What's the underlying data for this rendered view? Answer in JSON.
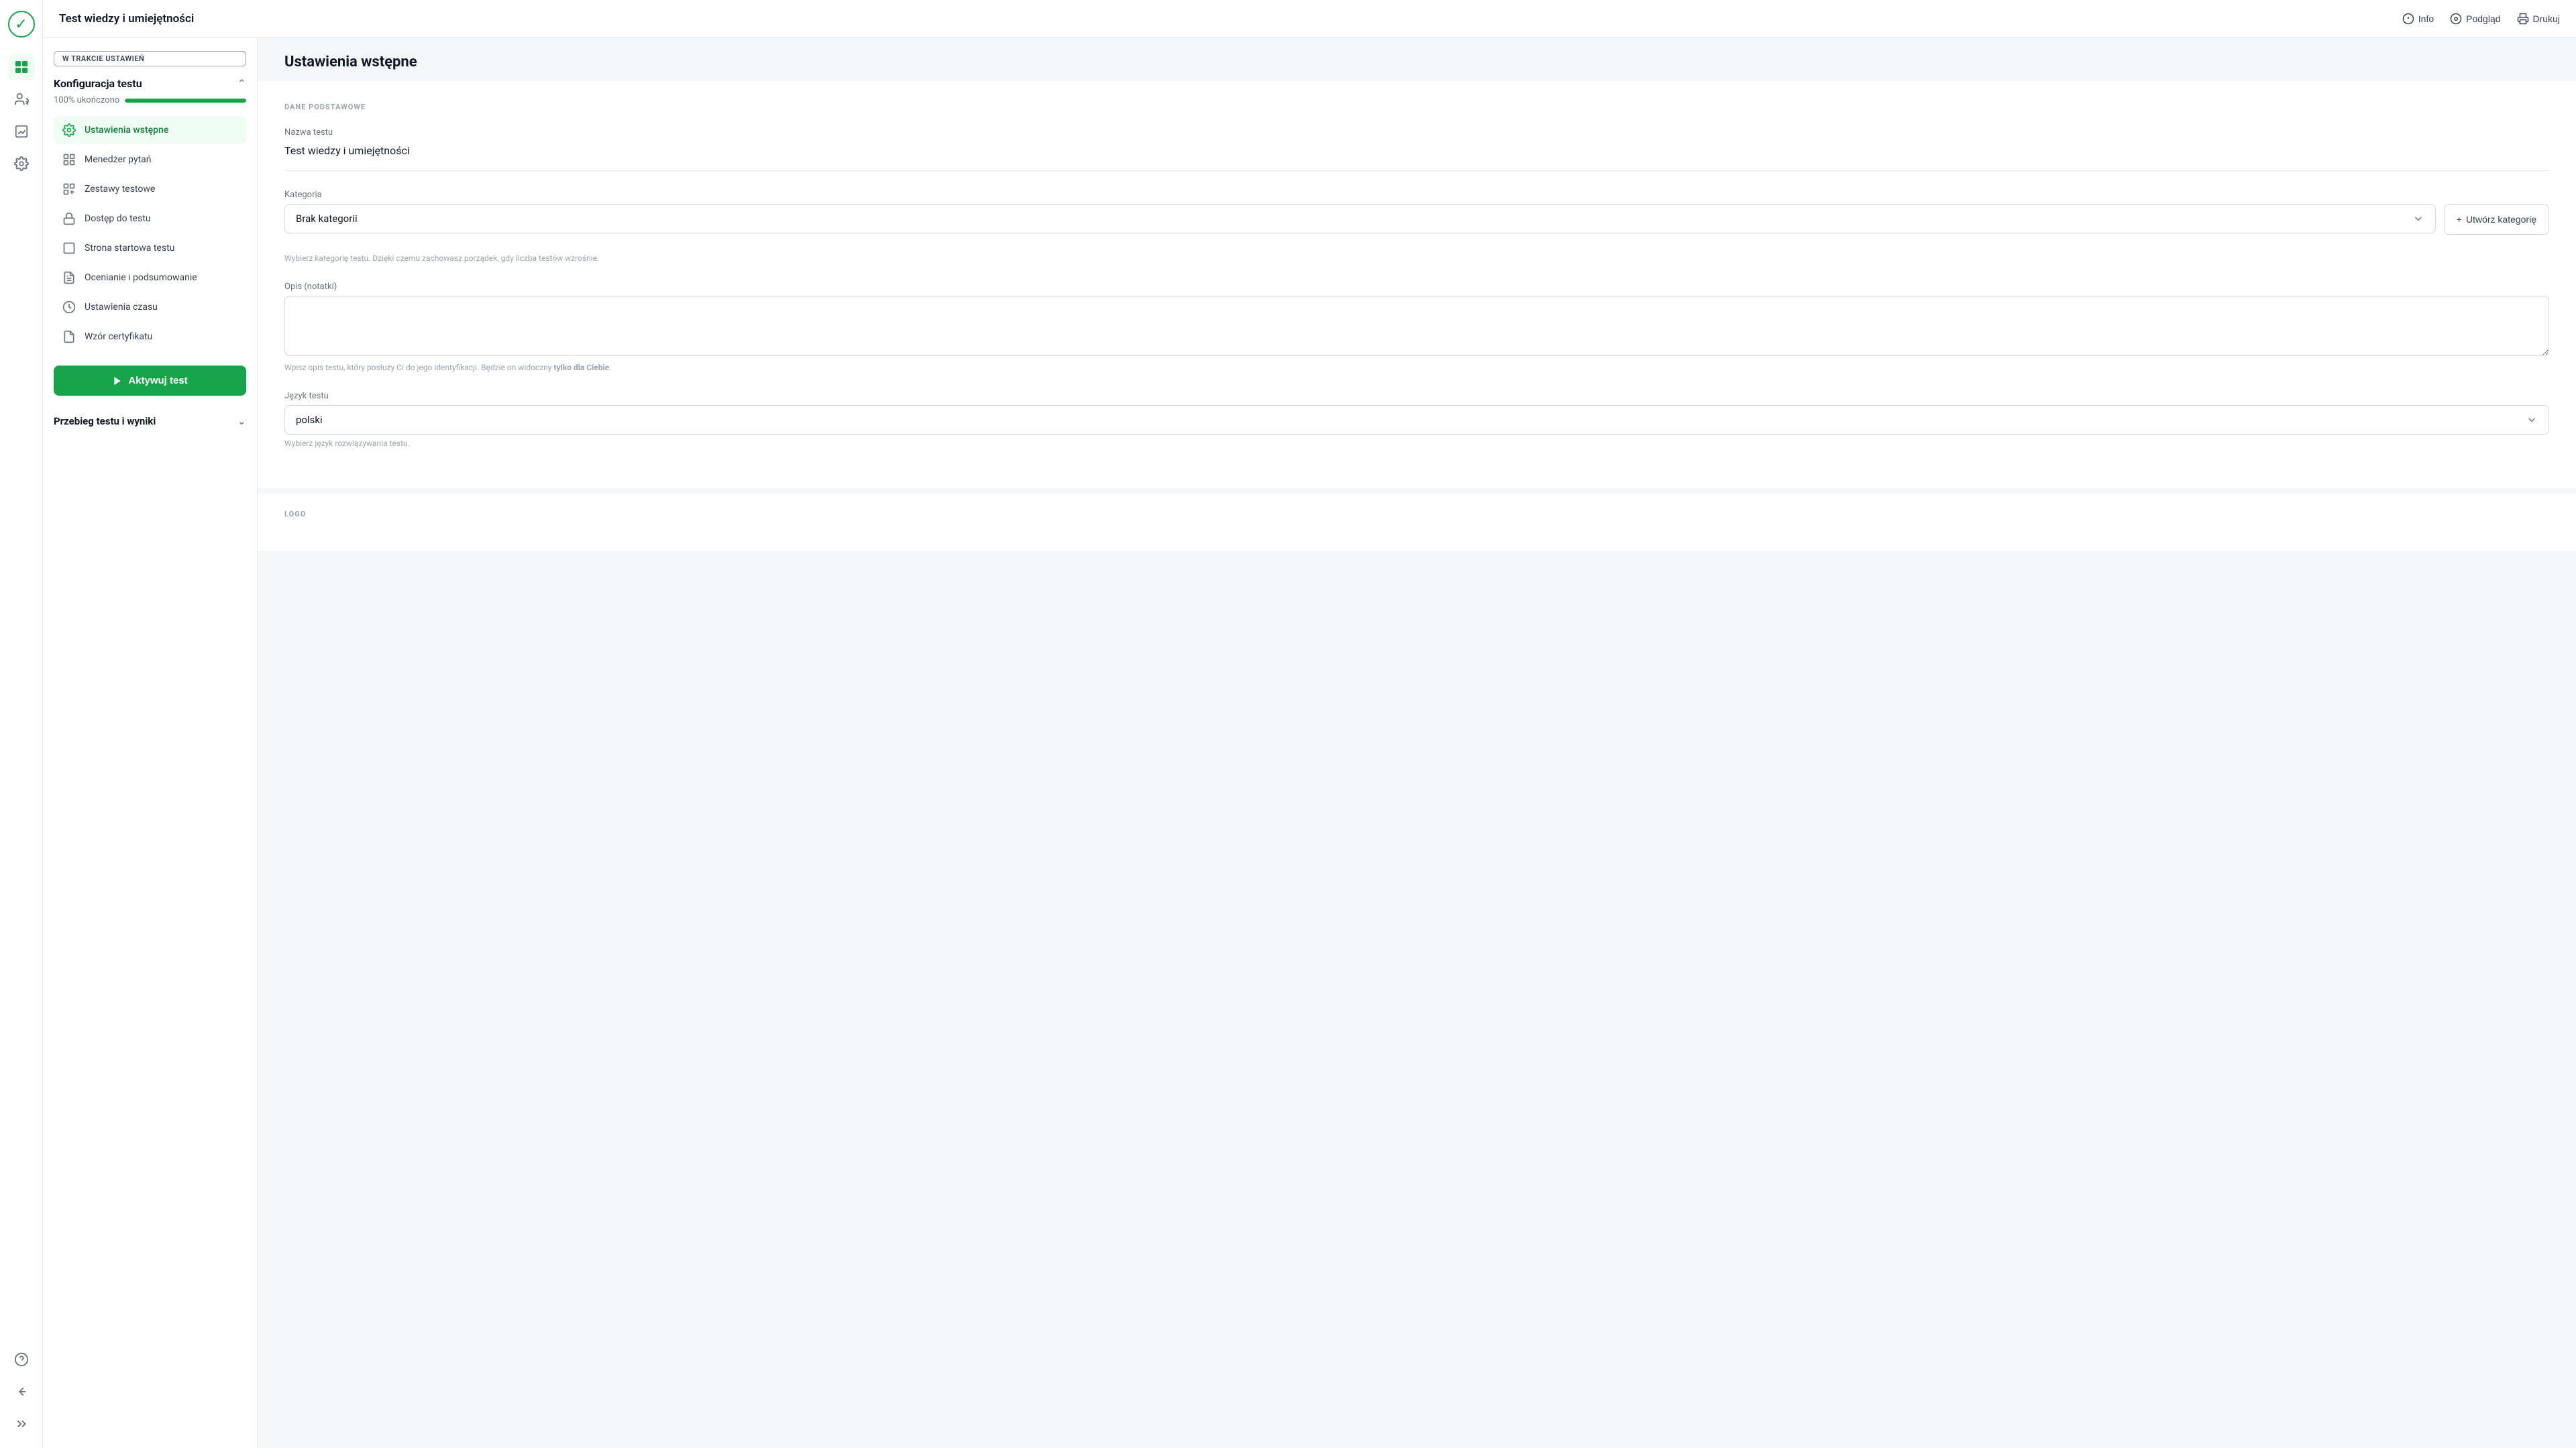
{
  "app": {
    "title": "Test wiedzy i umiejętności"
  },
  "header": {
    "title": "Test wiedzy i umiejętności",
    "actions": {
      "info": "Info",
      "preview": "Podgląd",
      "print": "Drukuj"
    }
  },
  "sidebar": {
    "status_badge": "W TRAKCIE USTAWIEŃ",
    "config_section": {
      "title": "Konfiguracja testu",
      "progress_label": "100% ukończono",
      "progress_value": 100
    },
    "nav_items": [
      {
        "id": "ustawienia-wstepne",
        "label": "Ustawienia wstępne",
        "icon": "⚙",
        "active": true
      },
      {
        "id": "menedzer-pytan",
        "label": "Menedżer pytań",
        "icon": "⊞",
        "active": false
      },
      {
        "id": "zestawy-testowe",
        "label": "Zestawy testowe",
        "icon": "⊟",
        "active": false
      },
      {
        "id": "dostep-do-testu",
        "label": "Dostęp do testu",
        "icon": "🔒",
        "active": false
      },
      {
        "id": "strona-startowa",
        "label": "Strona startowa testu",
        "icon": "◻",
        "active": false
      },
      {
        "id": "ocenianie",
        "label": "Ocenianie i podsumowanie",
        "icon": "📋",
        "active": false
      },
      {
        "id": "ustawienia-czasu",
        "label": "Ustawienia czasu",
        "icon": "🕐",
        "active": false
      },
      {
        "id": "wzor-certyfikatu",
        "label": "Wzór certyfikatu",
        "icon": "📄",
        "active": false
      }
    ],
    "activate_button": "Aktywuj test",
    "results_section": {
      "title": "Przebieg testu i wyniki"
    }
  },
  "main": {
    "page_title": "Ustawienia wstępne",
    "section_label": "DANE PODSTAWOWE",
    "fields": {
      "name_label": "Nazwa testu",
      "name_value": "Test wiedzy i umiejętności",
      "category_label": "Kategoria",
      "category_value": "Brak kategorii",
      "category_hint": "Wybierz kategorię testu. Dzięki czemu zachowasz porządek, gdy liczba testów wzrośnie.",
      "create_category_label": "+ Utwórz kategorię",
      "notes_label": "Opis (notatki)",
      "notes_placeholder": "",
      "notes_hint_prefix": "Wpisz opis testu, który posłuży Ci do jego identyfikacji. Będzie on widoczny ",
      "notes_hint_bold": "tylko dla Ciebie",
      "notes_hint_suffix": ".",
      "language_label": "Język testu",
      "language_value": "polski",
      "language_hint": "Wybierz język rozwiązywania testu."
    },
    "logo_section_label": "LOGO"
  },
  "nav_rail": {
    "icons": [
      {
        "id": "dashboard",
        "icon": "⊞"
      },
      {
        "id": "users",
        "icon": "👥"
      },
      {
        "id": "analytics",
        "icon": "📊"
      },
      {
        "id": "settings",
        "icon": "⚙"
      }
    ],
    "bottom_icons": [
      {
        "id": "help",
        "icon": "?"
      },
      {
        "id": "back",
        "icon": "↩"
      },
      {
        "id": "collapse",
        "icon": "»"
      }
    ]
  }
}
